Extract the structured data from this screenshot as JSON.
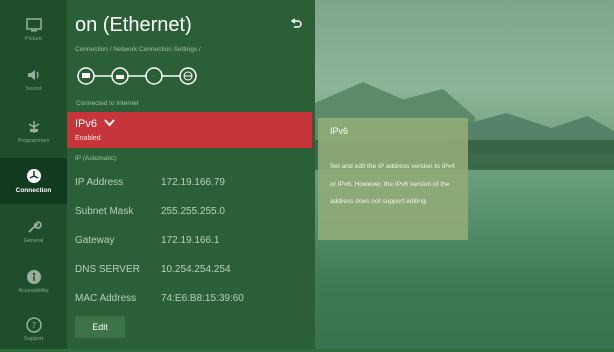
{
  "rail": {
    "items": [
      {
        "label": "Picture",
        "icon": "picture-icon"
      },
      {
        "label": "Sound",
        "icon": "speaker-icon"
      },
      {
        "label": "Programmes",
        "icon": "antenna-icon"
      },
      {
        "label": "Connection",
        "icon": "connection-icon",
        "active": true
      },
      {
        "label": "General",
        "icon": "wrench-icon"
      },
      {
        "label": "Accessibility",
        "icon": "accessibility-icon"
      },
      {
        "label": "Support",
        "icon": "support-icon"
      }
    ]
  },
  "header": {
    "title": "on (Ethernet)",
    "breadcrumb": "Connection / Network Connection Settings /",
    "back_icon": "back-icon"
  },
  "status": {
    "chain_icons": [
      "tv-icon",
      "router-icon",
      "dns-icon",
      "globe-icon"
    ],
    "text": "Connected to Internet"
  },
  "ipv6": {
    "label": "IPv6",
    "value": "Enabled"
  },
  "ip_mode": "IP (Automatic)",
  "details": [
    {
      "key": "IP Address",
      "value": "172.19.166.79"
    },
    {
      "key": "Subnet Mask",
      "value": "255.255.255.0"
    },
    {
      "key": "Gateway",
      "value": "172.19.166.1"
    },
    {
      "key": "DNS SERVER",
      "value": "10.254.254.254"
    },
    {
      "key": "MAC Address",
      "value": "74:E6:B8:15:39:60"
    }
  ],
  "edit_label": "Edit",
  "info": {
    "title": "IPv6",
    "body": "Set and edit the IP address version to IPv4 or IPv6. However, the IPv6 version of the address does not support editing."
  },
  "colors": {
    "accent_red": "#c6353a",
    "panel_green": "#2b5f37",
    "rail_green": "#1f4e2c"
  }
}
